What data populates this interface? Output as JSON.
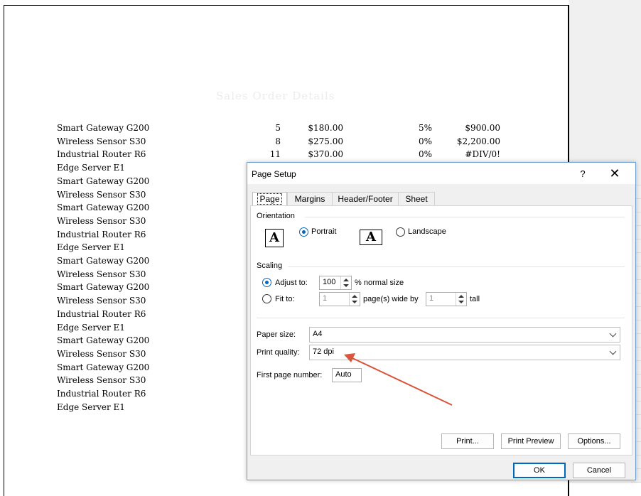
{
  "page": {
    "title": "Sales Order Details",
    "rows": [
      {
        "name": "Smart Gateway G200",
        "qty": "5",
        "price": "$180.00",
        "discount": "5%",
        "total": "$900.00"
      },
      {
        "name": "Wireless Sensor S30",
        "qty": "8",
        "price": "$275.00",
        "discount": "0%",
        "total": "$2,200.00"
      },
      {
        "name": "Industrial Router R6",
        "qty": "11",
        "price": "$370.00",
        "discount": "0%",
        "total": "#DIV/0!"
      },
      {
        "name": "Edge Server E1"
      },
      {
        "name": "Smart Gateway G200"
      },
      {
        "name": "Wireless Sensor S30"
      },
      {
        "name": "Smart Gateway G200"
      },
      {
        "name": "Wireless Sensor S30"
      },
      {
        "name": "Industrial Router R6"
      },
      {
        "name": "Edge Server E1"
      },
      {
        "name": "Smart Gateway G200"
      },
      {
        "name": "Wireless Sensor S30"
      },
      {
        "name": "Smart Gateway G200"
      },
      {
        "name": "Wireless Sensor S30"
      },
      {
        "name": "Industrial Router R6"
      },
      {
        "name": "Edge Server E1"
      },
      {
        "name": "Smart Gateway G200"
      },
      {
        "name": "Wireless Sensor S30"
      },
      {
        "name": "Smart Gateway G200"
      },
      {
        "name": "Wireless Sensor S30"
      },
      {
        "name": "Industrial Router R6"
      },
      {
        "name": "Edge Server E1"
      }
    ]
  },
  "dialog": {
    "title": "Page Setup",
    "help": "?",
    "close": "✕",
    "tabs": [
      "Page",
      "Margins",
      "Header/Footer",
      "Sheet"
    ],
    "orientation": {
      "heading": "Orientation",
      "portrait": "Portrait",
      "landscape": "Landscape",
      "icon_glyph": "A",
      "selected": "Portrait"
    },
    "scaling": {
      "heading": "Scaling",
      "adjust_label": "Adjust to:",
      "adjust_value": "100",
      "adjust_suffix": "% normal size",
      "fit_label": "Fit to:",
      "fit_wide_value": "1",
      "fit_wide_suffix": "page(s) wide by",
      "fit_tall_value": "1",
      "fit_tall_suffix": "tall",
      "selected": "Adjust to"
    },
    "paper_size": {
      "label": "Paper size:",
      "value": "A4"
    },
    "print_quality": {
      "label": "Print quality:",
      "value": "72 dpi"
    },
    "first_page": {
      "label": "First page number:",
      "value": "Auto"
    },
    "buttons": {
      "print": "Print...",
      "preview": "Print Preview",
      "options": "Options...",
      "ok": "OK",
      "cancel": "Cancel"
    }
  },
  "colors": {
    "accent": "#0067c0",
    "annotation_arrow": "#d9553b",
    "dialog_border": "#6fa0d6"
  }
}
